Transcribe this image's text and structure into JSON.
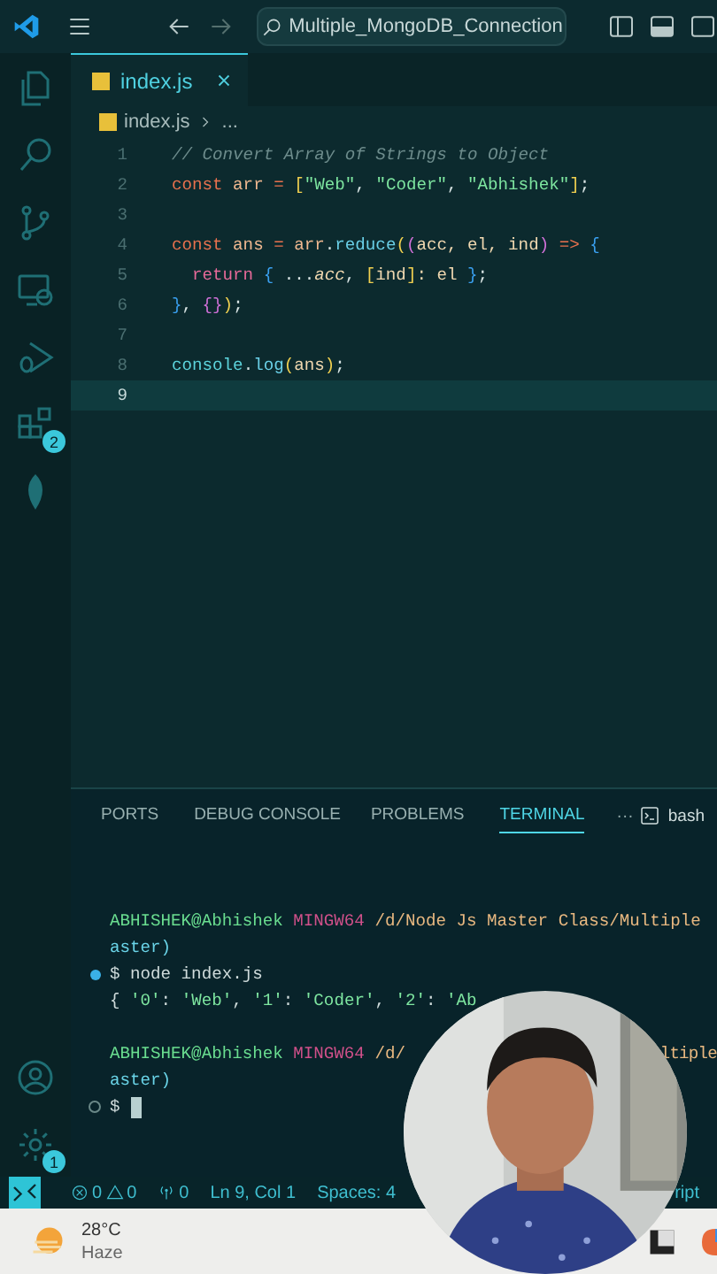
{
  "title_bar": {
    "search": "Multiple_MongoDB_Connection"
  },
  "activity_bar": {
    "top": [
      {
        "kind": "files",
        "selected": false
      },
      {
        "kind": "search",
        "selected": false
      },
      {
        "kind": "source-control",
        "selected": false
      },
      {
        "kind": "remote",
        "selected": false
      },
      {
        "kind": "debug",
        "selected": false
      },
      {
        "kind": "extensions",
        "selected": false,
        "badge": "2"
      },
      {
        "kind": "leaf",
        "selected": false
      }
    ],
    "bottom": [
      {
        "kind": "account",
        "selected": false
      },
      {
        "kind": "settings",
        "selected": false,
        "badge": "1"
      }
    ]
  },
  "editor": {
    "tabs": [
      {
        "label": "index.js",
        "selected": true
      }
    ],
    "breadcrumb": {
      "file": "index.js",
      "rest": "..."
    },
    "lines": [
      {
        "number": "1",
        "current": false,
        "tokens": [
          {
            "text": "// Convert Array of Strings to Object",
            "kind": "comment"
          }
        ]
      },
      {
        "number": "2",
        "current": false,
        "tokens": [
          {
            "text": "const",
            "kind": "keyword"
          },
          {
            "text": " arr ",
            "kind": "variable"
          },
          {
            "text": "=",
            "kind": "operator"
          },
          {
            "text": " [",
            "kind": "bracket"
          },
          {
            "text": "\"Web\"",
            "kind": "string"
          },
          {
            "text": ", ",
            "kind": "plain"
          },
          {
            "text": "\"Coder\"",
            "kind": "string"
          },
          {
            "text": ", ",
            "kind": "plain"
          },
          {
            "text": "\"Abhishek\"",
            "kind": "string"
          },
          {
            "text": "]",
            "kind": "bracket"
          },
          {
            "text": ";",
            "kind": "plain"
          }
        ]
      },
      {
        "number": "3",
        "current": false
      },
      {
        "number": "4",
        "current": false,
        "tokens": [
          {
            "text": "const",
            "kind": "keyword"
          },
          {
            "text": " ans ",
            "kind": "variable"
          },
          {
            "text": "=",
            "kind": "operator"
          },
          {
            "text": " arr",
            "kind": "variable"
          },
          {
            "text": ".",
            "kind": "plain"
          },
          {
            "text": "reduce",
            "kind": "function"
          },
          {
            "text": "(",
            "kind": "bracket"
          },
          {
            "text": "(",
            "kind": "paren"
          },
          {
            "text": "acc, el, ind",
            "kind": "parameter"
          },
          {
            "text": ")",
            "kind": "paren"
          },
          {
            "text": " =>",
            "kind": "operator"
          },
          {
            "text": " {",
            "kind": "brace"
          }
        ]
      },
      {
        "number": "5",
        "current": false,
        "tokens": [
          {
            "text": "  return",
            "kind": "control"
          },
          {
            "text": " {",
            "kind": "brace"
          },
          {
            "text": " ...",
            "kind": "plain"
          },
          {
            "text": "acc",
            "kind": "italic"
          },
          {
            "text": ", ",
            "kind": "plain"
          },
          {
            "text": "[",
            "kind": "bracket"
          },
          {
            "text": "ind",
            "kind": "parameter"
          },
          {
            "text": "]",
            "kind": "bracket"
          },
          {
            "text": ": el ",
            "kind": "parameter"
          },
          {
            "text": "}",
            "kind": "brace"
          },
          {
            "text": ";",
            "kind": "plain"
          }
        ]
      },
      {
        "number": "6",
        "current": false,
        "tokens": [
          {
            "text": "}",
            "kind": "brace"
          },
          {
            "text": ", ",
            "kind": "plain"
          },
          {
            "text": "{}",
            "kind": "paren"
          },
          {
            "text": ")",
            "kind": "bracket"
          },
          {
            "text": ";",
            "kind": "plain"
          }
        ]
      },
      {
        "number": "7",
        "current": false
      },
      {
        "number": "8",
        "current": false,
        "tokens": [
          {
            "text": "console",
            "kind": "object"
          },
          {
            "text": ".",
            "kind": "plain"
          },
          {
            "text": "log",
            "kind": "function"
          },
          {
            "text": "(",
            "kind": "bracket"
          },
          {
            "text": "ans",
            "kind": "parameter"
          },
          {
            "text": ")",
            "kind": "bracket"
          },
          {
            "text": ";",
            "kind": "plain"
          }
        ]
      },
      {
        "number": "9",
        "current": true
      }
    ]
  },
  "panel": {
    "tabs": [
      {
        "label": "PORTS",
        "selected": false
      },
      {
        "label": "DEBUG CONSOLE",
        "selected": false
      },
      {
        "label": "PROBLEMS",
        "selected": false
      },
      {
        "label": "TERMINAL",
        "selected": true
      }
    ],
    "more": "···",
    "shell": "bash",
    "terminal": [
      {
        "kind": "plain",
        "tokens": [
          {
            "text": "ABHISHEK@Abhishek",
            "kind": "user"
          },
          {
            "text": " MINGW64",
            "kind": "host"
          },
          {
            "text": " /d/Node Js Master Class/Multiple",
            "kind": "path"
          }
        ]
      },
      {
        "kind": "plain",
        "tokens": [
          {
            "text": "aster)",
            "kind": "branch"
          }
        ]
      },
      {
        "kind": "command-done",
        "tokens": [
          {
            "text": "$ node index.js",
            "kind": "plain"
          }
        ]
      },
      {
        "kind": "plain",
        "tokens": [
          {
            "text": "{ ",
            "kind": "plain"
          },
          {
            "text": "'0'",
            "kind": "string"
          },
          {
            "text": ": ",
            "kind": "plain"
          },
          {
            "text": "'Web'",
            "kind": "string"
          },
          {
            "text": ", ",
            "kind": "plain"
          },
          {
            "text": "'1'",
            "kind": "string"
          },
          {
            "text": ": ",
            "kind": "plain"
          },
          {
            "text": "'Coder'",
            "kind": "string"
          },
          {
            "text": ", ",
            "kind": "plain"
          },
          {
            "text": "'2'",
            "kind": "string"
          },
          {
            "text": ": ",
            "kind": "plain"
          },
          {
            "text": "'Ab",
            "kind": "string"
          }
        ]
      },
      {
        "kind": "plain"
      },
      {
        "kind": "plain",
        "tokens": [
          {
            "text": "ABHISHEK@Abhishek",
            "kind": "user"
          },
          {
            "text": " MINGW64",
            "kind": "host"
          },
          {
            "text": " /d/",
            "kind": "path"
          }
        ],
        "right": "ltiple"
      },
      {
        "kind": "plain",
        "tokens": [
          {
            "text": "aster)",
            "kind": "branch"
          }
        ]
      },
      {
        "kind": "command-idle",
        "tokens": [
          {
            "text": "$ ",
            "kind": "plain"
          }
        ],
        "cursor": true
      }
    ]
  },
  "status_bar": {
    "errors": "0",
    "warnings": "0",
    "ports": "0",
    "position": "Ln 9, Col 1",
    "indent": "Spaces: 4",
    "language": "ript"
  },
  "taskbar": {
    "temperature": "28°C",
    "condition": "Haze"
  }
}
